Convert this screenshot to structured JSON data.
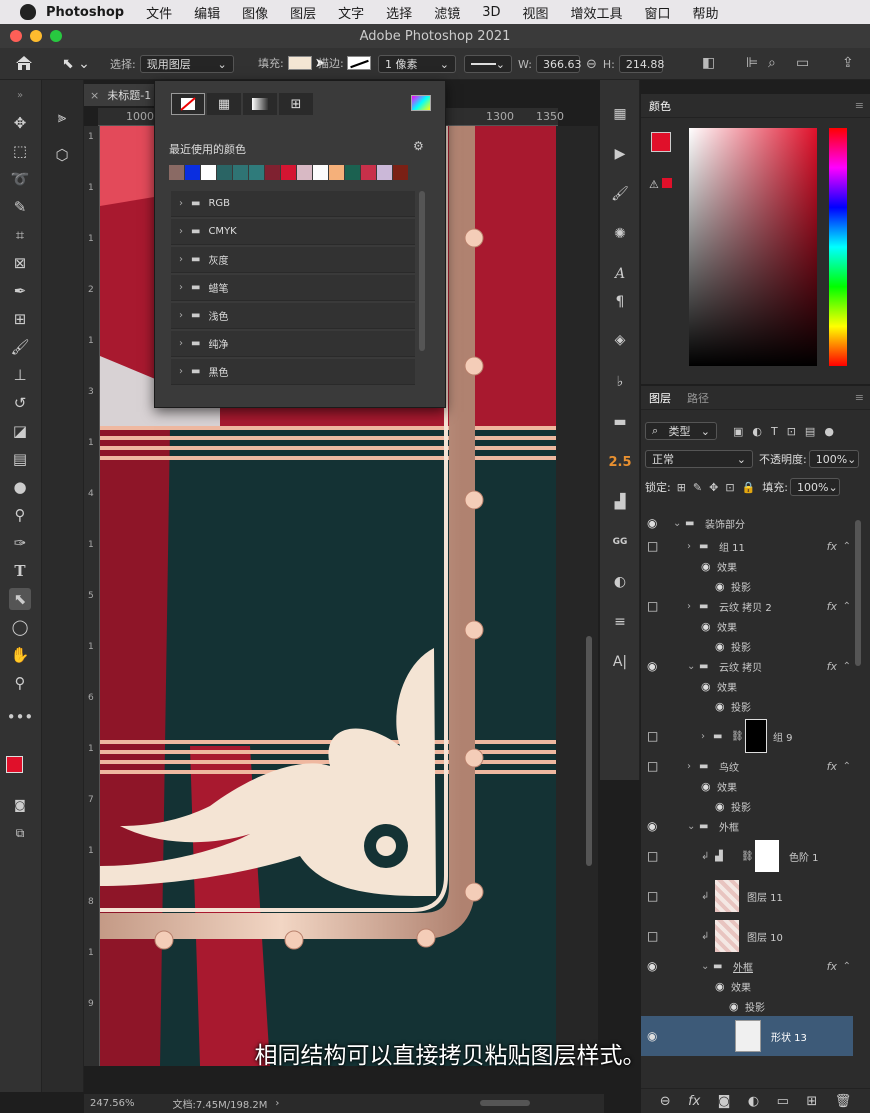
{
  "menubar": {
    "app": "Photoshop",
    "items": [
      "文件",
      "编辑",
      "图像",
      "图层",
      "文字",
      "选择",
      "滤镜",
      "3D",
      "视图",
      "增效工具",
      "窗口",
      "帮助"
    ]
  },
  "window": {
    "title": "Adobe Photoshop 2021"
  },
  "options": {
    "select_label": "选择:",
    "select_value": "现用图层",
    "fill_label": "填充:",
    "stroke_label": "描边:",
    "stroke_width": "1 像素",
    "w_label": "W:",
    "w_value": "366.63",
    "h_label": "H:",
    "h_value": "214.88"
  },
  "doc": {
    "tab_label": "未标题-1",
    "ruler_top": [
      "1000",
      "1300",
      "1350"
    ],
    "ruler_left": [
      "1",
      "1",
      "1",
      "2",
      "1",
      "3",
      "1",
      "4",
      "1",
      "5",
      "1",
      "6",
      "1",
      "7",
      "1",
      "8",
      "1",
      "9"
    ],
    "zoom": "247.56%",
    "doc_size": "文档:7.45M/198.2M"
  },
  "popup": {
    "recent_label": "最近使用的颜色",
    "swatches": [
      "#8a6a64",
      "#0a2ee0",
      "#ffffff",
      "#2a6464",
      "#2f7474",
      "#2f7b7b",
      "#7f2130",
      "#d41532",
      "#d8b9c4",
      "#fcfcfc",
      "#f5b07a",
      "#1b6150",
      "#c8304a",
      "#cbb8d8",
      "#7a2015"
    ],
    "folders": [
      "RGB",
      "CMYK",
      "灰度",
      "蜡笔",
      "浅色",
      "纯净",
      "黑色"
    ]
  },
  "color_panel": {
    "tab": "颜色",
    "fg": "#e0102a",
    "bg": "#000000"
  },
  "layers_panel": {
    "tabs": [
      "图层",
      "路径"
    ],
    "filter": "类型",
    "blend": "正常",
    "opacity_label": "不透明度:",
    "opacity": "100%",
    "lock_label": "锁定:",
    "fill_label": "填充:",
    "fill": "100%",
    "layers": [
      {
        "name": "装饰部分",
        "kind": "group",
        "indent": 0,
        "eye": true,
        "fx": false,
        "open": true
      },
      {
        "name": "组 11",
        "kind": "group",
        "indent": 1,
        "eye": false,
        "fx": true,
        "open": false
      },
      {
        "name": "效果",
        "kind": "effect",
        "indent": 2,
        "eye": false,
        "fx": false
      },
      {
        "name": "投影",
        "kind": "effect",
        "indent": 3,
        "eye": false,
        "fx": false
      },
      {
        "name": "云纹 拷贝 2",
        "kind": "group",
        "indent": 1,
        "eye": false,
        "fx": true,
        "open": false
      },
      {
        "name": "效果",
        "kind": "effect",
        "indent": 2,
        "eye": false,
        "fx": false
      },
      {
        "name": "投影",
        "kind": "effect",
        "indent": 3,
        "eye": false,
        "fx": false
      },
      {
        "name": "云纹 拷贝",
        "kind": "group",
        "indent": 1,
        "eye": true,
        "fx": true,
        "open": true
      },
      {
        "name": "效果",
        "kind": "effect",
        "indent": 2,
        "eye": false,
        "fx": false
      },
      {
        "name": "投影",
        "kind": "effect",
        "indent": 3,
        "eye": false,
        "fx": false
      },
      {
        "name": "组 9",
        "kind": "group-mask",
        "indent": 2,
        "eye": false,
        "fx": false,
        "open": false
      },
      {
        "name": "鸟纹",
        "kind": "group",
        "indent": 1,
        "eye": false,
        "fx": true,
        "open": false
      },
      {
        "name": "效果",
        "kind": "effect",
        "indent": 2,
        "eye": false,
        "fx": false
      },
      {
        "name": "投影",
        "kind": "effect",
        "indent": 3,
        "eye": false,
        "fx": false
      },
      {
        "name": "外框",
        "kind": "group",
        "indent": 1,
        "eye": true,
        "fx": false,
        "open": true
      },
      {
        "name": "色阶 1",
        "kind": "adjust",
        "indent": 2,
        "eye": false,
        "fx": false
      },
      {
        "name": "图层 11",
        "kind": "pixel",
        "indent": 2,
        "eye": false,
        "fx": false
      },
      {
        "name": "图层 10",
        "kind": "pixel",
        "indent": 2,
        "eye": false,
        "fx": false
      },
      {
        "name": "外框",
        "kind": "group",
        "indent": 2,
        "eye": true,
        "fx": true,
        "open": true
      },
      {
        "name": "效果",
        "kind": "effect",
        "indent": 3,
        "eye": false,
        "fx": false
      },
      {
        "name": "投影",
        "kind": "effect",
        "indent": 4,
        "eye": false,
        "fx": false
      },
      {
        "name": "形状 13",
        "kind": "shape",
        "indent": 3,
        "eye": true,
        "fx": false
      }
    ]
  },
  "subtitle": "相同结构可以直接拷贝粘贴图层样式。"
}
